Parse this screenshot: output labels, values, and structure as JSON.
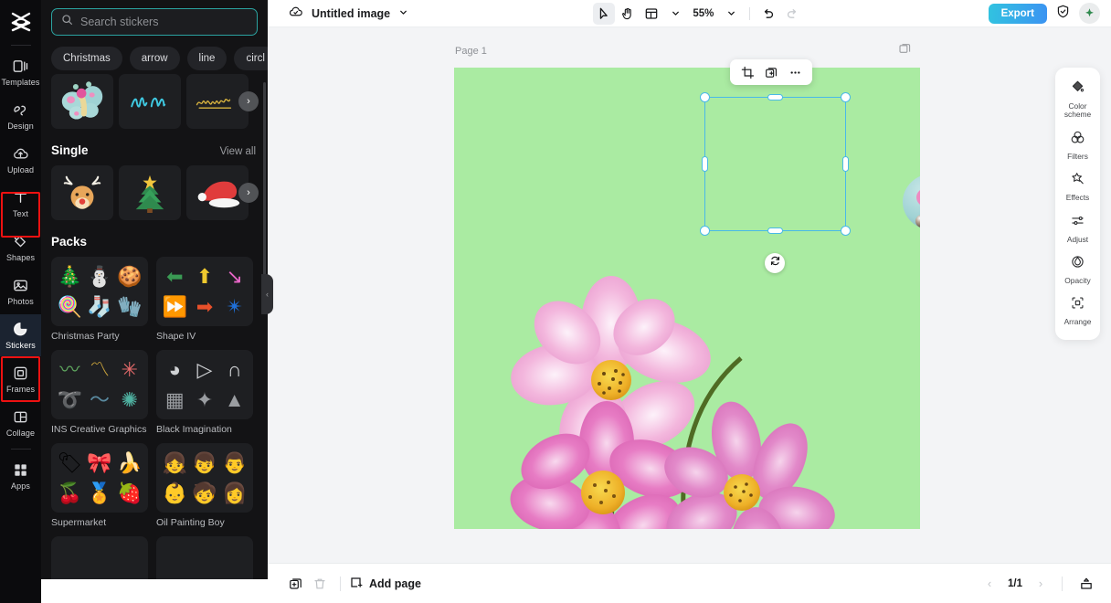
{
  "rail": {
    "logo_icon": "capcut-logo-icon",
    "items": [
      {
        "label": "Templates",
        "icon": "templates-icon",
        "highlight": false
      },
      {
        "label": "Design",
        "icon": "design-icon",
        "highlight": false
      },
      {
        "label": "Upload",
        "icon": "upload-cloud-icon",
        "highlight": false
      },
      {
        "label": "Text",
        "icon": "text-icon",
        "highlight": true
      },
      {
        "label": "Shapes",
        "icon": "shapes-icon",
        "highlight": false
      },
      {
        "label": "Photos",
        "icon": "photos-icon",
        "highlight": false
      },
      {
        "label": "Stickers",
        "icon": "stickers-icon",
        "highlight": true
      },
      {
        "label": "Frames",
        "icon": "frames-icon",
        "highlight": false
      },
      {
        "label": "Collage",
        "icon": "collage-icon",
        "highlight": false
      },
      {
        "label": "Apps",
        "icon": "apps-icon",
        "highlight": false
      }
    ],
    "highlight_color": "#ee1111"
  },
  "panel": {
    "search": {
      "placeholder": "Search stickers",
      "value": "",
      "icon": "search-icon",
      "border_color": "#2ba3a0"
    },
    "tags": [
      "Christmas",
      "arrow",
      "line",
      "circl"
    ],
    "recent_thumbs": [
      "butterfly-sticker",
      "blue-scribble-sticker",
      "gold-script-sticker"
    ],
    "carousel_next_icon": "chevron-right-icon",
    "single": {
      "title": "Single",
      "view_all": "View all",
      "thumbs": [
        "reindeer-sticker",
        "christmas-tree-sticker",
        "santa-hat-sticker"
      ]
    },
    "packs": {
      "title": "Packs",
      "items": [
        {
          "name": "Christmas Party",
          "glyphs": [
            "🎄",
            "⛄",
            "🍪",
            "🍭",
            "🧦",
            "🧤"
          ]
        },
        {
          "name": "Shape IV",
          "glyphs": [
            "⬅",
            "⬆",
            "↘",
            "⏩",
            "➡",
            "✴"
          ]
        },
        {
          "name": "INS Creative Graphics",
          "glyphs": [
            "〰",
            "〽",
            "✳",
            "➰",
            "〜",
            "✺"
          ]
        },
        {
          "name": "Black Imagination",
          "glyphs": [
            "◕",
            "▷",
            "∩",
            "▦",
            "✦",
            "▲"
          ]
        },
        {
          "name": "Supermarket",
          "glyphs": [
            "🏷",
            "🎀",
            "🍌",
            "🍒",
            "🏅",
            "🍓"
          ]
        },
        {
          "name": "Oil Painting Boy",
          "glyphs": [
            "👧",
            "👦",
            "👨",
            "👶",
            "🧒",
            "👩"
          ]
        }
      ]
    },
    "collapse_handle_icon": "chevron-left-icon"
  },
  "topbar": {
    "cloud_icon": "cloud-saved-icon",
    "doc_title": "Untitled image",
    "title_caret_icon": "chevron-down-icon",
    "tools": [
      {
        "name": "select-tool",
        "icon": "cursor-arrow-icon",
        "selected": true
      },
      {
        "name": "hand-tool",
        "icon": "hand-icon",
        "selected": false
      },
      {
        "name": "layout-tool",
        "icon": "layout-panel-icon",
        "selected": false
      }
    ],
    "layout_caret_icon": "chevron-down-icon",
    "zoom": "55%",
    "zoom_caret_icon": "chevron-down-icon",
    "undo_icon": "undo-icon",
    "redo_icon": "redo-icon",
    "export_label": "Export",
    "export_color": "#3b93f2",
    "shield_icon": "shield-check-icon",
    "avatar_icon": "user-avatar-icon"
  },
  "canvas": {
    "page_label": "Page 1",
    "page_corner_icon": "duplicate-page-icon",
    "background_color": "#aaeba2",
    "float_toolbar": [
      {
        "name": "crop-button",
        "icon": "crop-icon"
      },
      {
        "name": "duplicate-button",
        "icon": "duplicate-icon"
      },
      {
        "name": "more-button",
        "icon": "more-horizontal-icon"
      }
    ],
    "selection": {
      "color": "#49b9e8",
      "object": "butterfly-sticker"
    },
    "rotate_icon": "rotate-icon"
  },
  "right_panel": {
    "items": [
      {
        "label": "Color\nscheme",
        "label_l1": "Color",
        "label_l2": "scheme",
        "icon": "color-scheme-icon"
      },
      {
        "label": "Filters",
        "icon": "filters-icon"
      },
      {
        "label": "Effects",
        "icon": "effects-icon"
      },
      {
        "label": "Adjust",
        "icon": "adjust-sliders-icon"
      },
      {
        "label": "Opacity",
        "icon": "opacity-drop-icon"
      },
      {
        "label": "Arrange",
        "icon": "arrange-icon"
      }
    ]
  },
  "bottombar": {
    "duplicate_page_icon": "duplicate-page-icon",
    "delete_page_icon": "trash-icon",
    "add_page_label": "Add page",
    "add_page_icon": "add-page-icon",
    "prev_icon": "chevron-left-icon",
    "page_indicator": "1/1",
    "next_icon": "chevron-right-icon",
    "present_icon": "present-icon"
  }
}
